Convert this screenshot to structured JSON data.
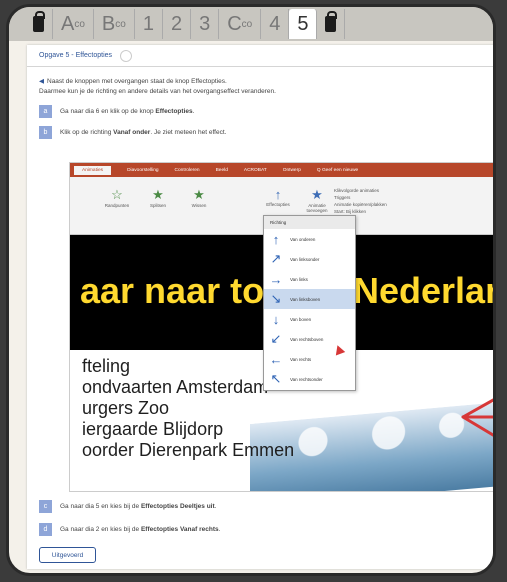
{
  "tabs": [
    {
      "label": "",
      "icon": "clipboard-lock-icon"
    },
    {
      "label": "A",
      "sup": "co"
    },
    {
      "label": "B",
      "sup": "co"
    },
    {
      "label": "1"
    },
    {
      "label": "2"
    },
    {
      "label": "3"
    },
    {
      "label": "C",
      "sup": "co"
    },
    {
      "label": "4"
    },
    {
      "label": "5"
    },
    {
      "label": "",
      "icon": "clipboard-lock-icon"
    }
  ],
  "page": {
    "title": "Opgave 5 - Effectopties",
    "intro_1": "Naast de knoppen met overgangen staat de knop Effectopties.",
    "intro_2": "Daarmee kun je de richting en andere details van het overgangseffect veranderen.",
    "steps": [
      {
        "num": "a",
        "text_prefix": "Ga naar dia 6 en klik op de knop ",
        "bold": "Effectopties",
        "text_suffix": "."
      },
      {
        "num": "b",
        "text_prefix": "Klik op de richting ",
        "bold": "Vanaf onder",
        "text_suffix": ". Je ziet meteen het effect."
      },
      {
        "num": "c",
        "text_prefix": "Ga naar dia 5 en kies bij de ",
        "bold": "Effectopties Deeltjes uit",
        "text_suffix": "."
      },
      {
        "num": "d",
        "text_prefix": "Ga naar dia 2 en kies bij de ",
        "bold": "Effectopties Vanaf rechts",
        "text_suffix": "."
      }
    ],
    "done_button": "Uitgevoerd"
  },
  "screenshot": {
    "ribbon_tabs": [
      "Animaties",
      "Diavoorstelling",
      "Controleren",
      "Beeld",
      "ACROBAT",
      "Ontwerp",
      "Q Geef een nieuwe"
    ],
    "effects": [
      "Randpunten",
      "Splitsen",
      "Wissen",
      "Effectopties",
      "Animatie toevoegen"
    ],
    "right_panel": [
      "Klikvolgorde animaties",
      "Triggers",
      "Animatie kopiëren/plakken",
      "Start: Bij klikken",
      "Duur",
      "Vertraging"
    ],
    "dropdown_title": "Richting",
    "directions": [
      {
        "label": "Van onderen",
        "icon": "arrow-up-icon",
        "glyph": "↑"
      },
      {
        "label": "Van linksonder",
        "icon": "arrow-up-right-icon",
        "glyph": "↗"
      },
      {
        "label": "Van links",
        "icon": "arrow-right-icon",
        "glyph": "→"
      },
      {
        "label": "Van linksboven",
        "icon": "arrow-down-right-icon",
        "glyph": "↘"
      },
      {
        "label": "Van boven",
        "icon": "arrow-down-icon",
        "glyph": "↓"
      },
      {
        "label": "Van rechtsboven",
        "icon": "arrow-down-left-icon",
        "glyph": "↙"
      },
      {
        "label": "Van rechts",
        "icon": "arrow-left-icon",
        "glyph": "←"
      },
      {
        "label": "Van rechtsonder",
        "icon": "arrow-up-left-icon",
        "glyph": "↖"
      }
    ],
    "slide_title_left": "aar naar to",
    "slide_title_right": "Nederlan",
    "list": [
      "fteling",
      "ondvaarten Amsterdam",
      "urgers Zoo",
      "iergaarde Blijdorp",
      "oorder Dierenpark Emmen"
    ]
  },
  "colors": {
    "accent": "#2f5597",
    "step_badge": "#8ea5d8",
    "ribbon": "#b7472a",
    "slide_text": "#ffd92f",
    "arrow": "#d73737"
  }
}
